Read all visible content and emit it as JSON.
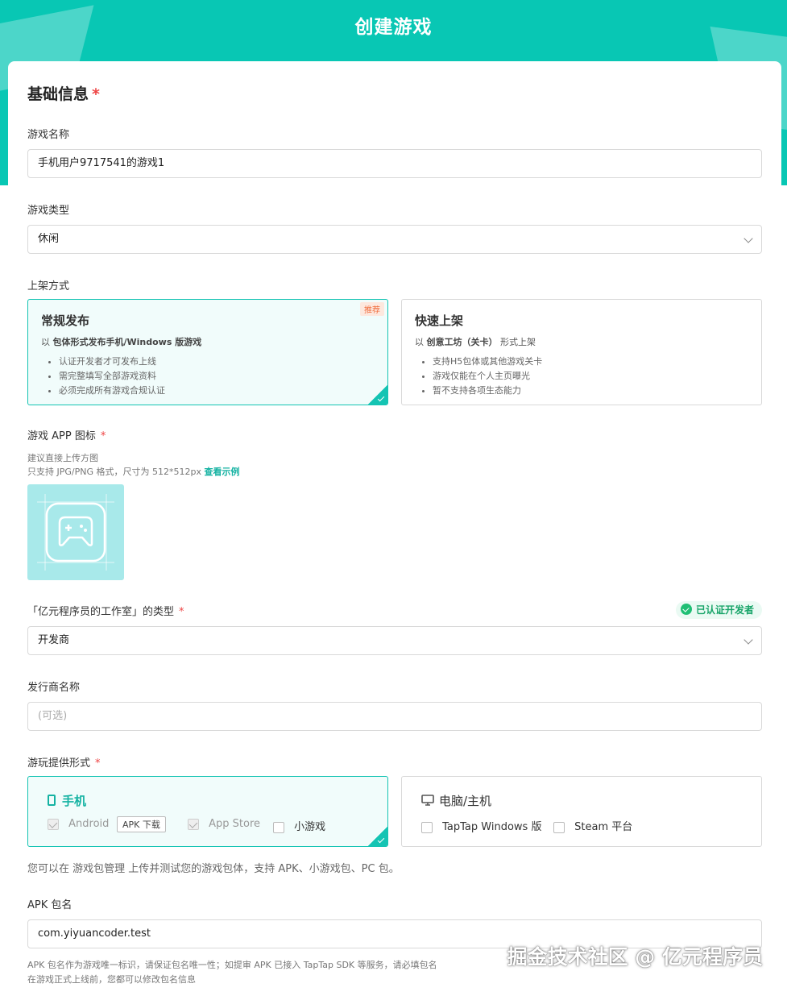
{
  "header": {
    "title": "创建游戏"
  },
  "basic": {
    "title": "基础信息",
    "star": "*"
  },
  "game_name": {
    "label": "游戏名称",
    "value": "手机用户9717541的游戏1"
  },
  "game_type": {
    "label": "游戏类型",
    "value": "休闲"
  },
  "listing": {
    "label": "上架方式",
    "regular": {
      "title": "常规发布",
      "badge": "推荐",
      "desc_prefix": "以 ",
      "desc_bold": "包体形式发布手机/Windows 版游戏",
      "desc_suffix": "",
      "bullets": [
        "认证开发者才可发布上线",
        "需完整填写全部游戏资料",
        "必须完成所有游戏合规认证"
      ]
    },
    "quick": {
      "title": "快速上架",
      "desc_prefix": "以 ",
      "desc_bold": "创意工坊（关卡）",
      "desc_suffix": " 形式上架",
      "bullets": [
        "支持H5包体或其他游戏关卡",
        "游戏仅能在个人主页曝光",
        "暂不支持各项生态能力"
      ]
    }
  },
  "icon_section": {
    "label": "游戏 APP 图标",
    "star": "*",
    "hint1": "建议直接上传方图",
    "hint2": "只支持 JPG/PNG 格式，尺寸为 512*512px",
    "example_link": "查看示例",
    "icon_name": "gamepad-icon"
  },
  "studio_type": {
    "label": "「亿元程序员的工作室」的类型",
    "star": "*",
    "value": "开发商",
    "verified": "已认证开发者"
  },
  "publisher": {
    "label": "发行商名称",
    "placeholder": "(可选)"
  },
  "play_form": {
    "label": "游玩提供形式",
    "star": "*",
    "mobile": {
      "title": "手机",
      "android": "Android",
      "apk_tag": "APK 下载",
      "appstore": "App Store",
      "mini": "小游戏"
    },
    "pc": {
      "title": "电脑/主机",
      "windows": "TapTap Windows 版",
      "steam": "Steam 平台"
    },
    "note": "您可以在 游戏包管理 上传并测试您的游戏包体，支持 APK、小游戏包、PC 包。"
  },
  "apk": {
    "label": "APK 包名",
    "value": "com.yiyuancoder.test",
    "hint1": "APK 包名作为游戏唯一标识，请保证包名唯一性；如提审 APK 已接入 TapTap SDK 等服务，请必填包名",
    "hint2": "在游戏正式上线前，您都可以修改包名信息"
  },
  "watermark": "掘金技术社区 @ 亿元程序员",
  "colors": {
    "accent": "#08c7b4",
    "required": "#e44444",
    "badge": "#f06c3c"
  }
}
